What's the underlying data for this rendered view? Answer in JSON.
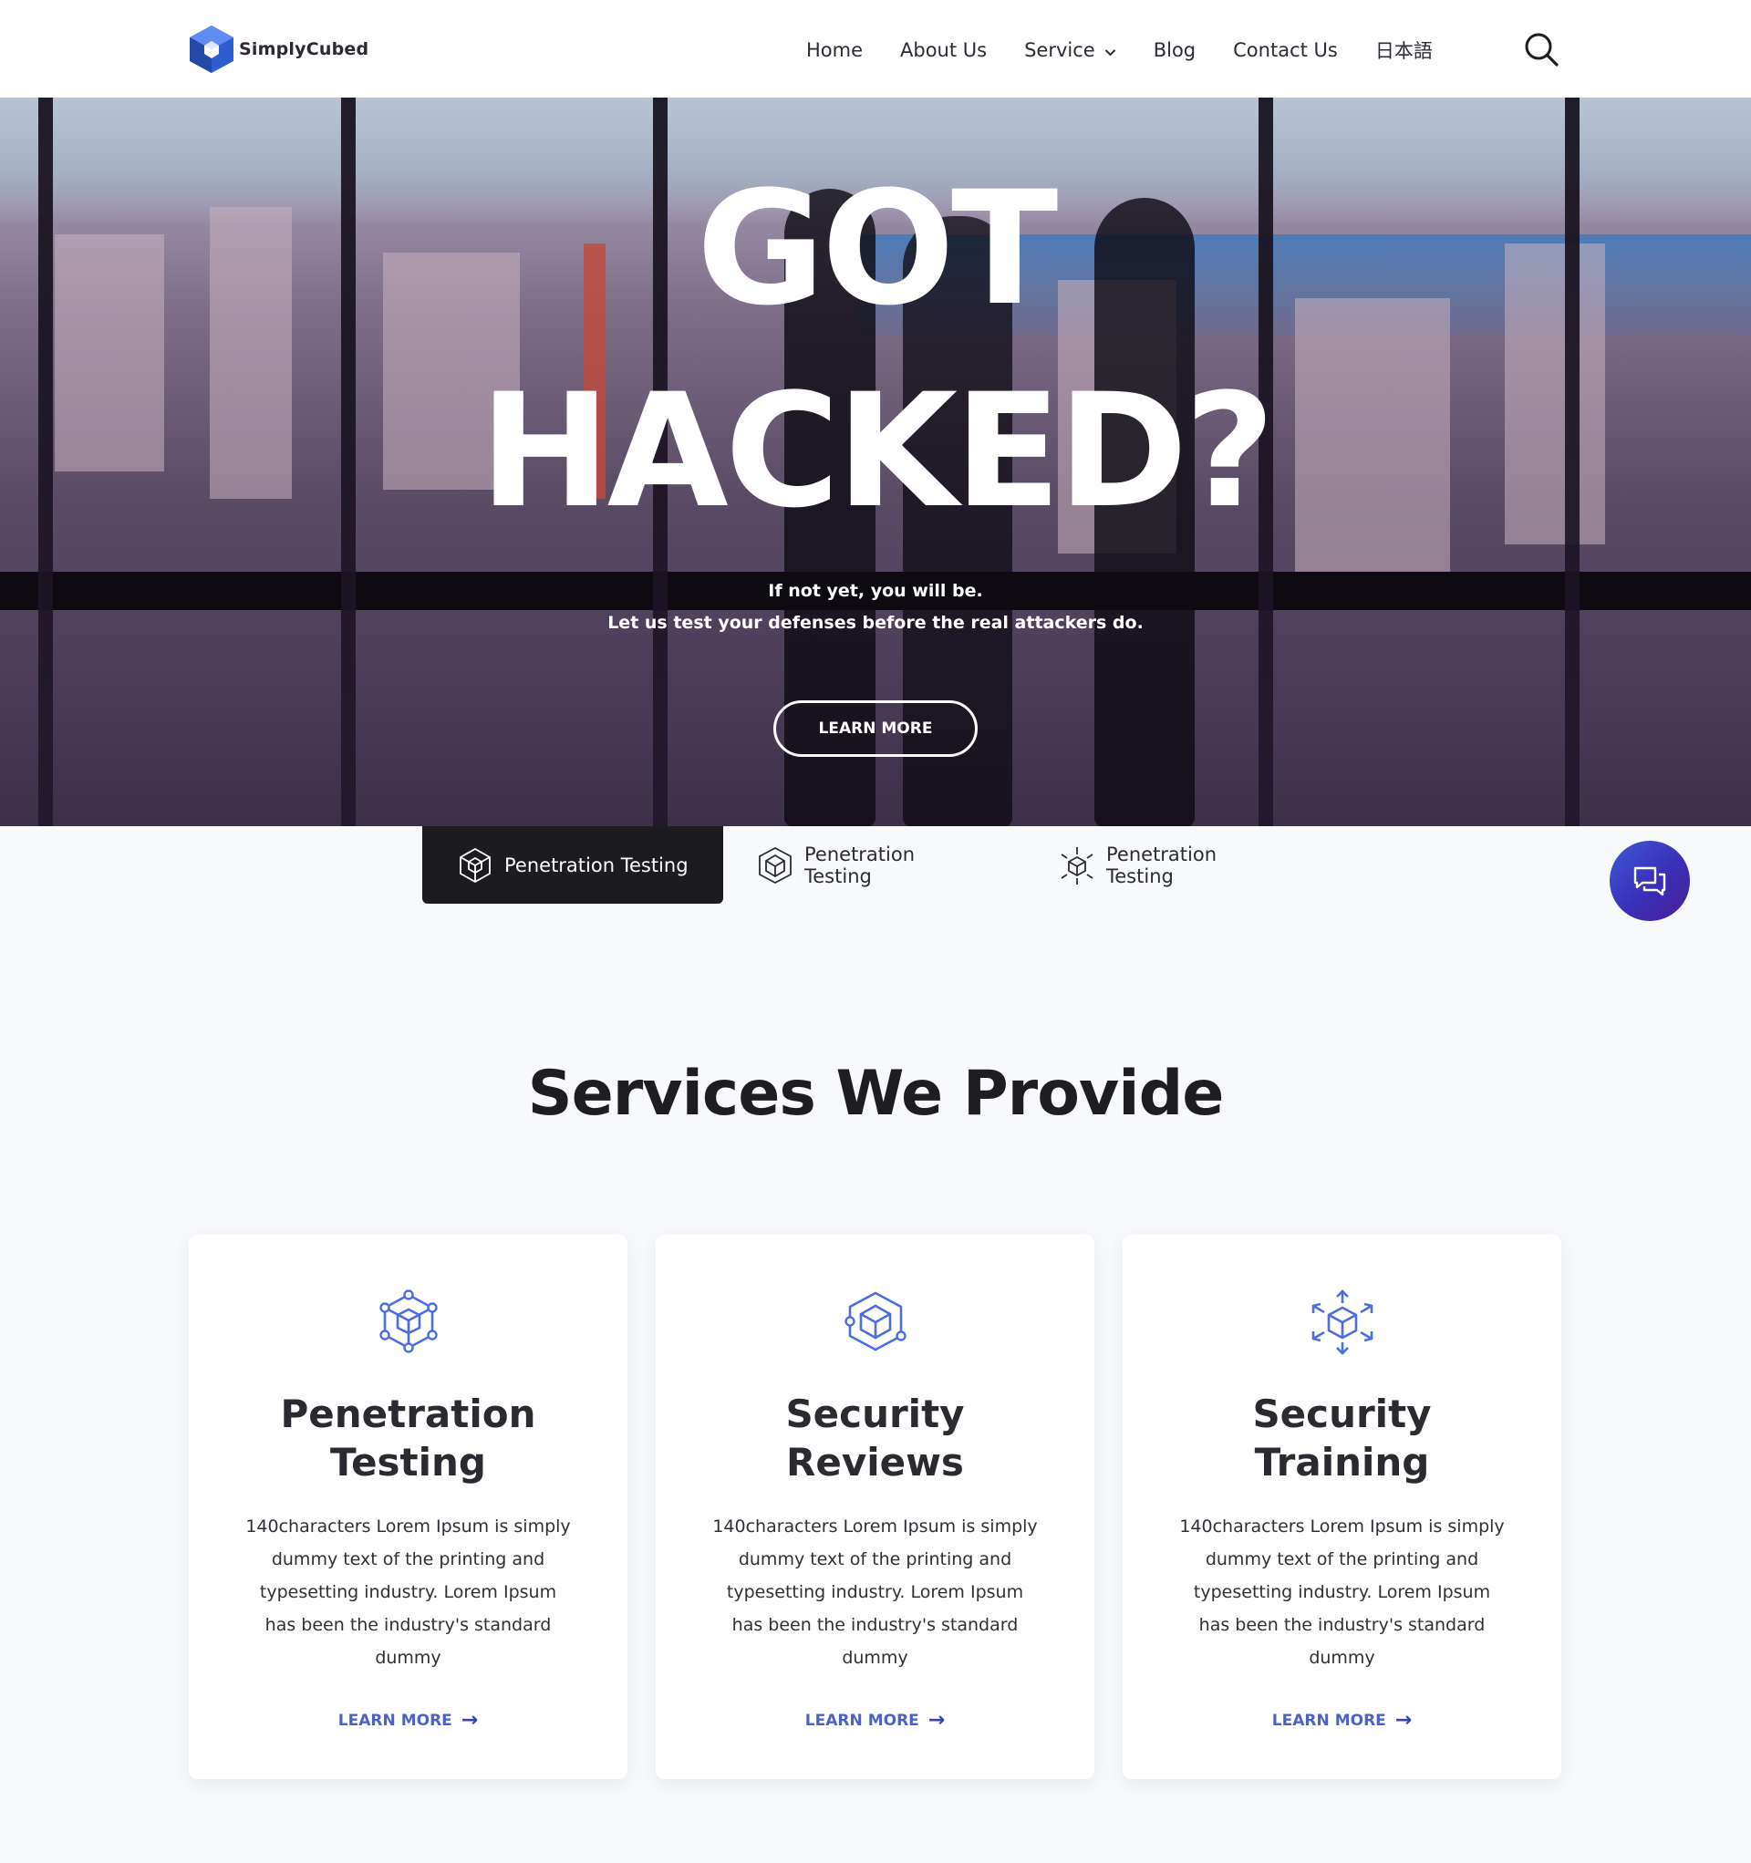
{
  "header": {
    "logo_text": "SimplyCubed",
    "nav": [
      {
        "label": "Home"
      },
      {
        "label": "About Us"
      },
      {
        "label": "Service"
      },
      {
        "label": "Blog"
      },
      {
        "label": "Contact Us"
      },
      {
        "label": "日本語"
      }
    ],
    "search_icon": "search-icon"
  },
  "hero": {
    "title_line1": "GOT",
    "title_line2": "HACKED?",
    "subtitle_line1": "If not yet, you will be.",
    "subtitle_line2": "Let us test your defenses before the real attackers do.",
    "cta_label": "LEARN MORE"
  },
  "tabs": [
    {
      "label": "Penetration Testing",
      "icon": "cube-network-icon",
      "active": true
    },
    {
      "label": "Penetration Testing",
      "icon": "cube-ring-icon",
      "active": false
    },
    {
      "label": "Penetration Testing",
      "icon": "cube-arrows-icon",
      "active": false
    }
  ],
  "chat": {
    "icon": "chat-icon"
  },
  "services": {
    "title": "Services We Provide",
    "cards": [
      {
        "title_line1": "Penetration",
        "title_line2": "Testing",
        "description": "140characters Lorem Ipsum is simply dummy text of the printing and typesetting industry. Lorem Ipsum has been the industry's standard dummy",
        "link_learn": "LEARN",
        "link_more": "MORE",
        "icon": "cube-network-icon"
      },
      {
        "title_line1": "Security",
        "title_line2": "Reviews",
        "description": "140characters Lorem Ipsum is simply dummy text of the printing and typesetting industry. Lorem Ipsum has been the industry's standard dummy",
        "link_learn": "LEARN",
        "link_more": "MORE",
        "icon": "cube-ring-icon"
      },
      {
        "title_line1": "Security",
        "title_line2": "Training",
        "description": "140characters Lorem Ipsum is simply dummy text of the printing and typesetting industry. Lorem Ipsum has been the industry's standard dummy",
        "link_learn": "LEARN",
        "link_more": "MORE",
        "icon": "cube-arrows-icon"
      }
    ]
  },
  "colors": {
    "accent_blue": "#4a6ee0",
    "link_blue": "#4a63c8",
    "dark_tab": "#1c1c20",
    "chat_gradient_start": "#3e58d8",
    "chat_gradient_end": "#4a1f96"
  }
}
